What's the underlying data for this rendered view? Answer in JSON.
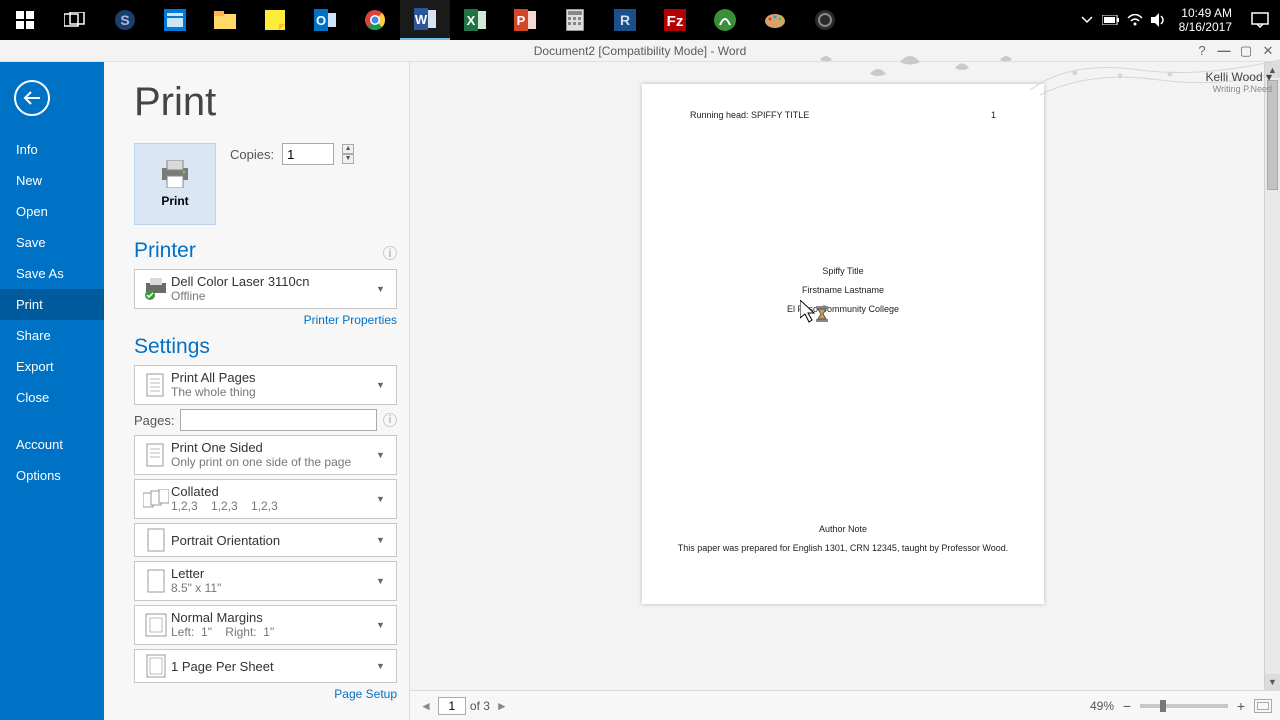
{
  "taskbar": {
    "clock_time": "10:49 AM",
    "clock_date": "8/16/2017"
  },
  "titlebar": {
    "title": "Document2 [Compatibility Mode] - Word"
  },
  "user": {
    "name": "Kelli Wood",
    "badge": "Writing P.Need"
  },
  "sidebar": {
    "items": [
      "Info",
      "New",
      "Open",
      "Save",
      "Save As",
      "Print",
      "Share",
      "Export",
      "Close"
    ],
    "items2": [
      "Account",
      "Options"
    ],
    "active": "Print"
  },
  "print": {
    "heading": "Print",
    "btn_label": "Print",
    "copies_label": "Copies:",
    "copies_value": "1"
  },
  "printer": {
    "heading": "Printer",
    "name": "Dell Color Laser 3110cn",
    "status": "Offline",
    "properties": "Printer Properties"
  },
  "settings": {
    "heading": "Settings",
    "pages_label": "Pages:",
    "page_setup": "Page Setup",
    "items": [
      {
        "t": "Print All Pages",
        "s": "The whole thing"
      },
      {
        "t": "Print One Sided",
        "s": "Only print on one side of the page"
      },
      {
        "t": "Collated",
        "s": "1,2,3    1,2,3    1,2,3"
      },
      {
        "t": "Portrait Orientation",
        "s": ""
      },
      {
        "t": "Letter",
        "s": "8.5\" x 11\""
      },
      {
        "t": "Normal Margins",
        "s": "Left:  1\"    Right:  1\""
      },
      {
        "t": "1 Page Per Sheet",
        "s": ""
      }
    ]
  },
  "preview": {
    "running_head": "Running head: SPIFFY TITLE",
    "page_no": "1",
    "title": "Spiffy Title",
    "author": "Firstname Lastname",
    "school": "El Paso Community College",
    "note_head": "Author Note",
    "note_body": "This paper was prepared for English 1301, CRN 12345, taught by Professor Wood.",
    "nav_page": "1",
    "nav_total": "of 3",
    "zoom": "49%"
  }
}
